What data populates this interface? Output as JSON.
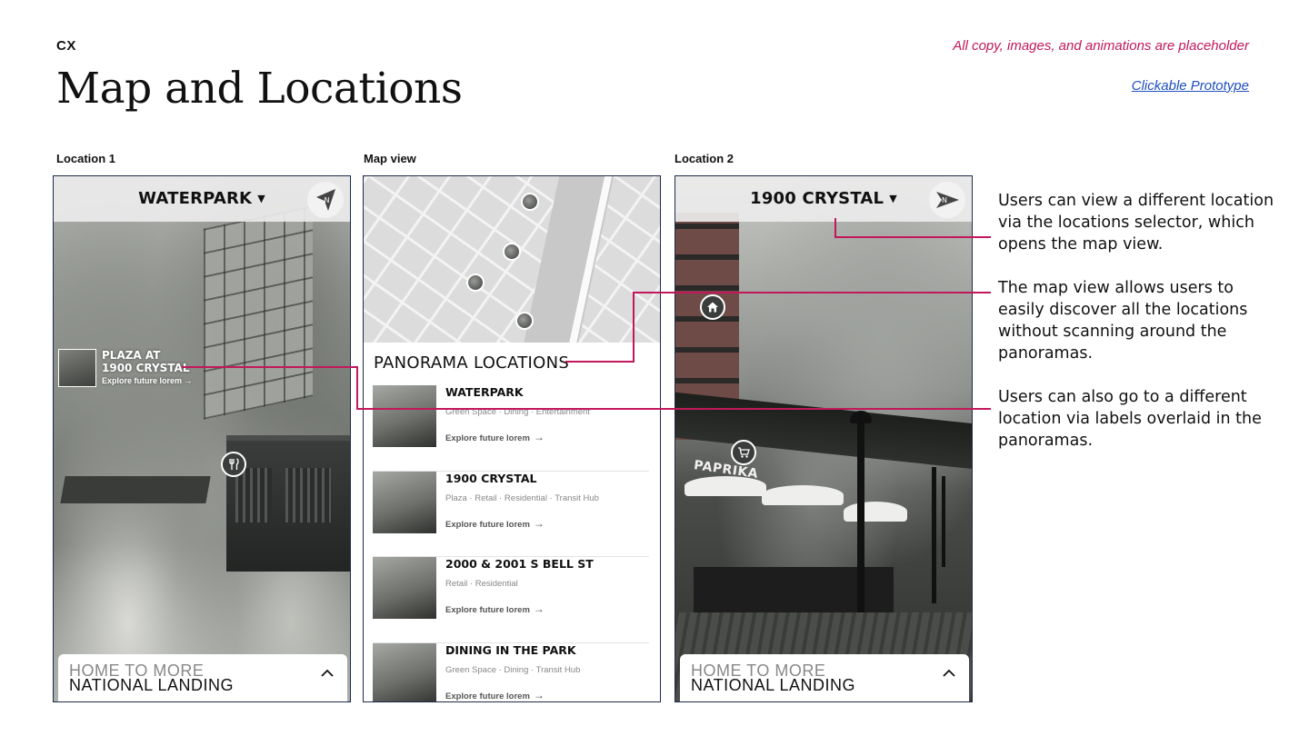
{
  "header": {
    "tag": "CX",
    "title": "Map and Locations",
    "note": "All copy, images, and animations are placeholder",
    "prototype_link": "Clickable Prototype"
  },
  "columns": {
    "location1_label": "Location 1",
    "mapview_label": "Map view",
    "location2_label": "Location 2"
  },
  "location1": {
    "selector": "WATERPARK",
    "compass": "N",
    "poi": {
      "line1": "PLAZA AT",
      "line2": "1900 CRYSTAL",
      "link": "Explore future lorem →"
    },
    "pin_icon": "fork-knife-icon",
    "card": {
      "line1": "HOME TO MORE",
      "line2": "NATIONAL LANDING"
    }
  },
  "mapview": {
    "heading": "PANORAMA LOCATIONS",
    "items": [
      {
        "name": "WATERPARK",
        "tags": "Green Space · Dining · Entertainment",
        "link": "Explore future lorem"
      },
      {
        "name": "1900 CRYSTAL",
        "tags": "Plaza · Retail · Residential · Transit Hub",
        "link": "Explore future lorem"
      },
      {
        "name": "2000 & 2001 S BELL ST",
        "tags": "Retail · Residential",
        "link": "Explore future lorem"
      },
      {
        "name": "DINING IN THE PARK",
        "tags": "Green Space · Dining · Transit Hub",
        "link": "Explore future lorem"
      }
    ]
  },
  "location2": {
    "selector": "1900 CRYSTAL",
    "compass": "N",
    "sign": "PAPRIKA",
    "pin_icons": [
      "home-icon",
      "cart-icon"
    ],
    "card": {
      "line1": "HOME TO MORE",
      "line2": "NATIONAL LANDING"
    }
  },
  "annotations": [
    "Users can view a different location via the locations selector, which opens the map view.",
    "The map view allows users to easily discover all the locations without scanning around the panoramas.",
    "Users can also go to a different location via labels overlaid in the panoramas."
  ],
  "colors": {
    "accent": "#c2185b",
    "link": "#1f4fbf",
    "frame": "#1d2b4a"
  }
}
